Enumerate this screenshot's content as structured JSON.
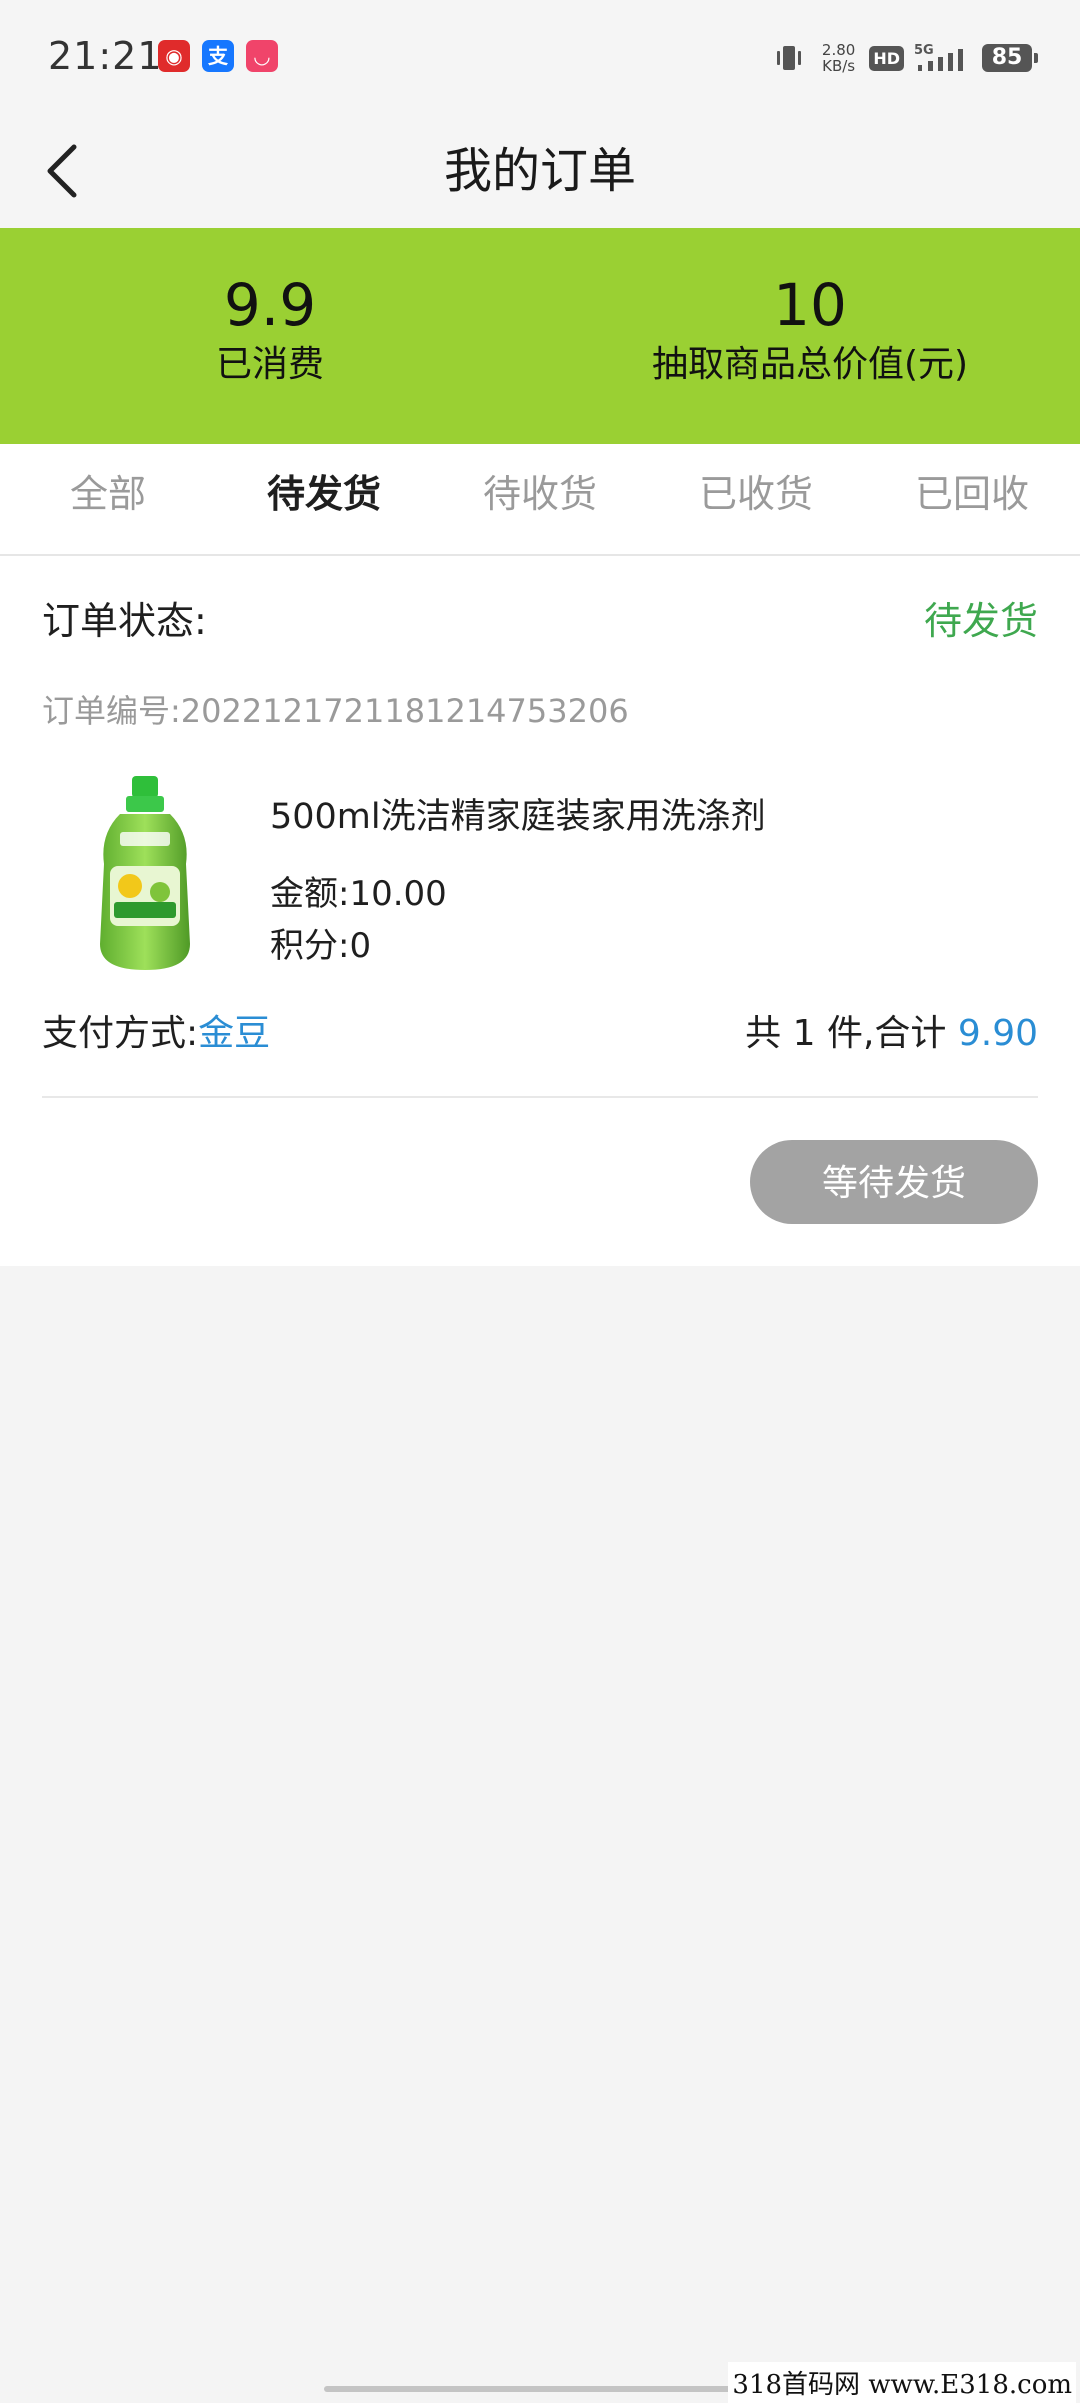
{
  "status_bar": {
    "time": "21:21",
    "net_speed_value": "2.80",
    "net_speed_unit": "KB/s",
    "hd": "HD",
    "network": "5G",
    "battery": "85",
    "icons": [
      "netease-music-icon",
      "alipay-icon",
      "app-icon",
      "vibrate-icon",
      "signal-icon",
      "battery-icon"
    ]
  },
  "header": {
    "title": "我的订单"
  },
  "summary": {
    "consumed_value": "9.9",
    "consumed_label": "已消费",
    "total_value": "10",
    "total_label": "抽取商品总价值(元)",
    "color": "#9ad033"
  },
  "tabs": [
    {
      "label": "全部",
      "active": false
    },
    {
      "label": "待发货",
      "active": true
    },
    {
      "label": "待收货",
      "active": false
    },
    {
      "label": "已收货",
      "active": false
    },
    {
      "label": "已回收",
      "active": false
    }
  ],
  "order": {
    "status_label": "订单状态:",
    "status_value": "待发货",
    "status_color": "#3fa84f",
    "number": "订单编号:20221217211812147532​06",
    "product_name": "500ml洗洁精家庭装家用洗涤剂",
    "amount": "金额:10.00",
    "points": "积分:0",
    "payment_label": "支付方式:",
    "payment_value": "金豆",
    "total_prefix": "共 1 件,合计 ",
    "total_amount": "9.90",
    "accent_color": "#2a8dd4",
    "action_button": "等待发货"
  },
  "watermark": "318首码网 www.E318.com"
}
